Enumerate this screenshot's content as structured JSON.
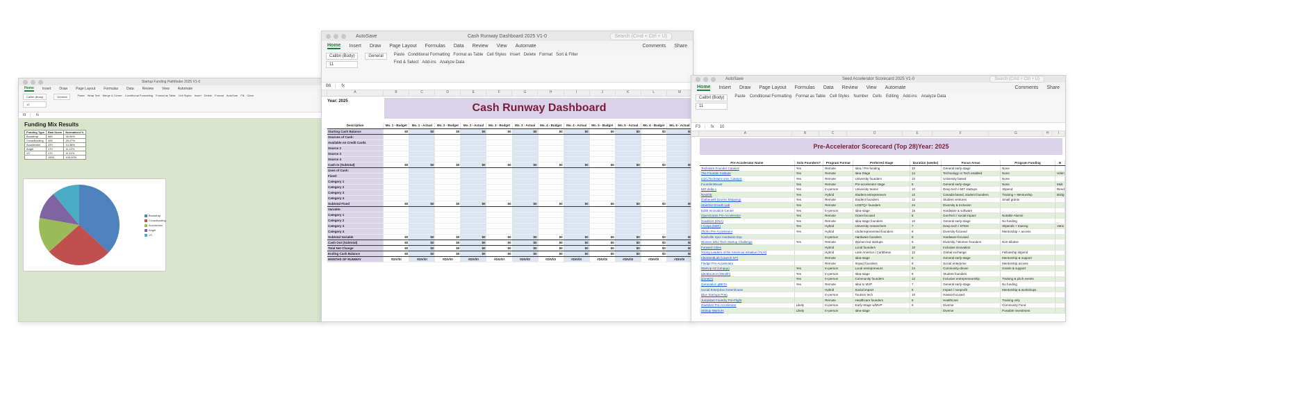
{
  "w1": {
    "title": "Startup Funding Pathfinder 2025 V1-0",
    "tabs": [
      "Home",
      "Insert",
      "Draw",
      "Page Layout",
      "Formulas",
      "Data",
      "Review",
      "View",
      "Automate"
    ],
    "font": "Calibri (Body)",
    "font_size": "12",
    "number_format": "General",
    "ribbon": [
      "Paste",
      "Wrap Text",
      "Merge & Center",
      "Conditional Formatting",
      "Format as Table",
      "Cell Styles",
      "Insert",
      "Delete",
      "Format",
      "AutoSum",
      "Fill",
      "Clear"
    ],
    "name_box": "I9",
    "sheet_title": "Funding Mix Results",
    "table_header": [
      "Funding Type",
      "Raw Score",
      "Normalized %"
    ],
    "rows": [
      [
        "Bootstrap",
        "565",
        "36.99%"
      ],
      [
        "Crowdfunding",
        "405",
        "26.47%"
      ],
      [
        "Accelerator",
        "220",
        "14.38%"
      ],
      [
        "Angel",
        "170",
        "11.11%"
      ],
      [
        "VC",
        "170",
        "11.11%"
      ]
    ],
    "total": [
      "1530",
      "100.00%"
    ],
    "legend": [
      "Bootstrap",
      "Crowdfunding",
      "Accelerator",
      "Angel",
      "VC"
    ],
    "colors": [
      "#4f81bd",
      "#c0504d",
      "#9bbb59",
      "#8064a2",
      "#4bacc6"
    ]
  },
  "chart_data": {
    "type": "pie",
    "categories": [
      "Bootstrap",
      "Crowdfunding",
      "Accelerator",
      "Angel",
      "VC"
    ],
    "values": [
      36.99,
      26.47,
      14.38,
      11.11,
      11.11
    ],
    "title": ""
  },
  "w2": {
    "autosave": "AutoSave",
    "title": "Cash Runway Dashboard 2025 V1-0",
    "search": "Search (Cmd + Ctrl + U)",
    "tabs": [
      "Home",
      "Insert",
      "Draw",
      "Page Layout",
      "Formulas",
      "Data",
      "Review",
      "View",
      "Automate"
    ],
    "comments": "Comments",
    "share": "Share",
    "font": "Calibri (Body)",
    "font_size": "11",
    "number_format": "General",
    "ribbon": [
      "Paste",
      "Conditional Formatting",
      "Format as Table",
      "Cell Styles",
      "Insert",
      "Delete",
      "Format",
      "Sort & Filter",
      "Find & Select",
      "Add-ins",
      "Analyze Data"
    ],
    "name_box": "B6",
    "formula": "fx",
    "columns": [
      "A",
      "B",
      "C",
      "D",
      "E",
      "F",
      "G",
      "H",
      "I",
      "J",
      "K",
      "L",
      "M"
    ],
    "year": "Year: 2025",
    "dashboard_title": "Cash Runway Dashboard",
    "month_headers": [
      "Mo. 1 - Budget",
      "Mo. 1 - Actual",
      "Mo. 2 - Budget",
      "Mo. 2 - Actual",
      "Mo. 3 - Budget",
      "Mo. 3 - Actual",
      "Mo. 4 - Budget",
      "Mo. 4 - Actual",
      "Mo. 5 - Budget",
      "Mo. 5 - Actual",
      "Mo. 6 - Budget",
      "Mo. 6 - Actual"
    ],
    "desc_label": "Description",
    "rows": [
      {
        "n": "3",
        "label": "Starting Cash Balance",
        "type": "money"
      },
      {
        "n": "5",
        "label": "Sources of Cash:",
        "type": "head"
      },
      {
        "n": "7",
        "label": "Available on Credit Cards",
        "type": "blank"
      },
      {
        "n": "8",
        "label": "Source 2",
        "type": "blank"
      },
      {
        "n": "9",
        "label": "Source 3",
        "type": "blank"
      },
      {
        "n": "10",
        "label": "Source 4",
        "type": "blank"
      },
      {
        "n": "13",
        "label": "Cash In (Subtotal)",
        "type": "money"
      },
      {
        "n": "15",
        "label": "Uses of Cash:",
        "type": "head"
      },
      {
        "n": "17",
        "label": "Fixed:",
        "type": "head"
      },
      {
        "n": "18",
        "label": "Category 1",
        "type": "blank"
      },
      {
        "n": "19",
        "label": "Category 2",
        "type": "blank"
      },
      {
        "n": "20",
        "label": "Category 3",
        "type": "blank"
      },
      {
        "n": "21",
        "label": "Category 4",
        "type": "blank"
      },
      {
        "n": "22",
        "label": "Subtotal Fixed",
        "type": "money"
      },
      {
        "n": "24",
        "label": "Variable:",
        "type": "head"
      },
      {
        "n": "25",
        "label": "Category 1",
        "type": "blank"
      },
      {
        "n": "26",
        "label": "Category 2",
        "type": "blank"
      },
      {
        "n": "27",
        "label": "Category 3",
        "type": "blank"
      },
      {
        "n": "28",
        "label": "Category 4",
        "type": "blank"
      },
      {
        "n": "29",
        "label": "Subtotal Variable",
        "type": "money"
      },
      {
        "n": "31",
        "label": "Cash Out (Subtotal)",
        "type": "money"
      },
      {
        "n": "33",
        "label": "Total Net Change",
        "type": "money"
      },
      {
        "n": "35",
        "label": "Ending Cash Balance",
        "type": "money"
      },
      {
        "n": "37",
        "label": "MONTHS OF RUNWAY",
        "type": "div"
      }
    ],
    "money_value": "$0",
    "div_value": "#DIV/0!"
  },
  "w3": {
    "autosave": "AutoSave",
    "title": "Seed Accelerator Scorecard 2025 V1-0",
    "search": "Search (Cmd + Ctrl + U)",
    "tabs": [
      "Home",
      "Insert",
      "Draw",
      "Page Layout",
      "Formulas",
      "Data",
      "Review",
      "View",
      "Automate"
    ],
    "comments": "Comments",
    "share": "Share",
    "font": "Calibri (Body)",
    "font_size": "11",
    "ribbon": [
      "Paste",
      "Conditional Formatting",
      "Format as Table",
      "Cell Styles",
      "Number",
      "Cells",
      "Editing",
      "Add-ins",
      "Analyze Data"
    ],
    "name_box": "F3",
    "formula_value": "10",
    "columns": [
      "A",
      "B",
      "C",
      "D",
      "E",
      "F",
      "G",
      "H",
      "I"
    ],
    "sheet_title": "Pre-Accelerator Scorecard (Top 28)Year: 2025",
    "headers": [
      "Pre-Accelerator Name",
      "Solo Founders?",
      "Program Format",
      "Preferred Stage",
      "Duration (weeks)",
      "Focus Areas",
      "Program Funding",
      "N"
    ],
    "rows": [
      [
        "Techstars Founder Catalyst",
        "Yes",
        "Remote",
        "Idea / Pre-funding",
        "10",
        "General early-stage",
        "None",
        ""
      ],
      [
        "The Founder Institute",
        "Yes",
        "Remote",
        "Idea Stage",
        "14",
        "Technology or Tech enabled",
        "None",
        "Udemy"
      ],
      [
        "USC/Techstars Univ. Catalyst",
        "Yes",
        "Remote",
        "University founders",
        "10",
        "University based",
        "None",
        ""
      ],
      [
        "FoundersBoost",
        "Yes",
        "Remote",
        "Pre-accelerator stage",
        "6",
        "General early-stage",
        "None",
        "Mult"
      ],
      [
        "MIT delta v",
        "Yes",
        "In-person",
        "University teams",
        "10",
        "Deep tech / MIT startups",
        "Stipend",
        "Rend"
      ],
      [
        "NextGE",
        "Yes",
        "Hybrid",
        "Student entrepreneurs",
        "12",
        "Canada-based, student founders",
        "Training + Mentorship",
        "Bridg"
      ],
      [
        "Gatherwell (Dorms Mapping)",
        "Yes",
        "Remote",
        "Student founders",
        "12",
        "Student ventures",
        "Small grants",
        ""
      ],
      [
        "StartOut Growth Lab",
        "Yes",
        "Remote",
        "LGBTQ+ founders",
        "24",
        "Diversity & Inclusion",
        "",
        ""
      ],
      [
        "Edith Innovation Center",
        "Yes",
        "In-person",
        "Idea-stage",
        "16",
        "Hardware & software",
        "",
        ""
      ],
      [
        "OpenGrants Pre-Accelerator",
        "Yes",
        "Remote",
        "Grant-focused",
        "8",
        "GovTech / social impact",
        "Notable Alumni",
        ""
      ],
      [
        "Gradt110 (DSA)",
        "Yes",
        "Remote",
        "Idea-stage founders",
        "10",
        "General early-stage",
        "No funding",
        ""
      ],
      [
        "I-Corps (NSF)",
        "Yes",
        "Hybrid",
        "University researchers",
        "7",
        "Deep tech / STEM",
        "Stipends + training",
        "Vario"
      ],
      [
        "Zhoho Pre-Accelerator",
        "Yes",
        "Hybrid",
        "Underrepresented founders",
        "8",
        "Diversity-focused",
        "Mentorship + access",
        ""
      ],
      [
        "Nashville Spur Hardware Exp",
        "",
        "In-person",
        "Hardware founders",
        "8",
        "Hardware-focused",
        "",
        ""
      ],
      [
        "Women Who Tech Startup Challenge",
        "Yes",
        "Remote",
        "Women-led startups",
        "6",
        "Diversity / Women founders",
        "Non-dilutive",
        ""
      ],
      [
        "Forward Cities",
        "",
        "Hybrid",
        "Local founders",
        "10",
        "Inclusive innovation",
        "",
        ""
      ],
      [
        "Young Leaders of the Americas Initiative (YLAI)",
        "",
        "Hybrid",
        "Latin America / Caribbean",
        "12",
        "Global exchange",
        "Fellowship stipend",
        ""
      ],
      [
        "IdeaSeedLab (Launch NY)",
        "",
        "Remote",
        "Idea-stage",
        "6",
        "General early-stage",
        "Mentorship & support",
        ""
      ],
      [
        "Fledge Pre-Accelerator",
        "",
        "Remote",
        "Impact founders",
        "8",
        "Social enterprise",
        "Mentorship access",
        ""
      ],
      [
        "StartUp AZ (Umpqu)",
        "Yes",
        "In-person",
        "Local entrepreneurs",
        "24",
        "Community-driven",
        "Grants & support",
        ""
      ],
      [
        "IdeaBounce (Wealth)",
        "Yes",
        "In-person",
        "Idea-stage",
        "8",
        "Student founders",
        "",
        ""
      ],
      [
        "iZone(A)",
        "Yes",
        "In-person",
        "Community founders",
        "12",
        "Inclusive entrepreneurship",
        "Training & pitch events",
        ""
      ],
      [
        "Generation gBETA",
        "Yes",
        "Remote",
        "Idea to MVP",
        "7",
        "General early-stage",
        "No funding",
        ""
      ],
      [
        "Social Enterprise Greenhouse",
        "",
        "Hybrid",
        "Social impact",
        "6",
        "Impact / nonprofit",
        "Mentorship & workshops",
        ""
      ],
      [
        "Blue Startups Prep",
        "",
        "In-person",
        "Tourism tech",
        "10",
        "Hawaii-focused",
        "",
        ""
      ],
      [
        "Jumpstart Foundry Pre-Flight",
        "",
        "Remote",
        "Healthcare founders",
        "8",
        "Healthcare",
        "Training only",
        ""
      ],
      [
        "Gaeldom Pre-Accelerator",
        "Likely",
        "In-person",
        "Early-Stage w/MVP",
        "6",
        "Diverse",
        "Community Fund",
        ""
      ],
      [
        "Startup Warriors",
        "Likely",
        "In-person",
        "Idea-stage",
        "",
        "Diverse",
        "Possible Investment",
        ""
      ]
    ]
  }
}
